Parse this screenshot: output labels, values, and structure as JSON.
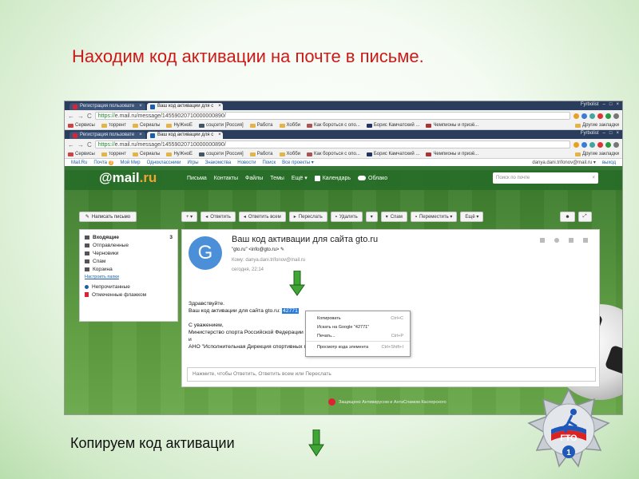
{
  "slide": {
    "title": "Находим код активации на почте в письме.",
    "caption": "Копируем код активации"
  },
  "browser": {
    "tabs": [
      {
        "label": "Регистрация пользовате",
        "active": false
      },
      {
        "label": "Ваш код активации для с",
        "active": true
      }
    ],
    "top_right": "Fyrbolist",
    "url_https": "https://",
    "url_rest": "e.mail.ru/message/14559020710000000890/",
    "bookmarks": [
      "Сервисы",
      "торрент",
      "Сериалы",
      "НуЖноЕ",
      "соцсети [Россия]",
      "Работа",
      "Хобби",
      "Как бороться с опо...",
      "Борис Камчатский ...",
      "Чемпионы и призё..."
    ],
    "other_bookmarks": "Другие закладки"
  },
  "mail": {
    "top_links": [
      "Mail.Ru",
      "Почта",
      "Мой Мир",
      "Одноклассники",
      "Игры",
      "Знакомства",
      "Новости",
      "Поиск",
      "Все проекты ▾"
    ],
    "mail_count": "3",
    "user_email": "danya.dani.trifonov@mail.ru ▾",
    "exit": "выход",
    "logo_at": "@mail",
    "logo_ru": ".ru",
    "nav": [
      "Письма",
      "Контакты",
      "Файлы",
      "Темы",
      "Ещё ▾"
    ],
    "calendar": "Календарь",
    "cloud": "Облако",
    "search_placeholder": "Поиск по почте",
    "write_button": "Написать письмо",
    "toolbar": {
      "plus": "+ ▾",
      "reply": "Ответить",
      "reply_all": "Ответить всем",
      "forward": "Переслать",
      "delete": "Удалить",
      "more_delete": "▾",
      "spam": "Спам",
      "move": "Переместить ▾",
      "more": "Ещё ▾"
    },
    "folders": [
      {
        "name": "Входящие",
        "count": "3",
        "bold": true
      },
      {
        "name": "Отправленные",
        "count": ""
      },
      {
        "name": "Черновики",
        "count": ""
      },
      {
        "name": "Спам",
        "count": ""
      },
      {
        "name": "Корзина",
        "count": ""
      }
    ],
    "folder_settings": "Настроить папки",
    "unread": "Непрочитанные",
    "flagged": "Отмеченные флажком",
    "message": {
      "avatar_letter": "G",
      "subject": "Ваш код активации для сайта gto.ru",
      "from": "\"gto.ru\" <info@gto.ru> ✎",
      "to": "Кому: danya.dani.trifonov@mail.ru",
      "date": "сегодня, 22:14",
      "greeting": "Здравствуйте.",
      "code_line": "Ваш код активации для сайта gto.ru: ",
      "code": "42771",
      "regards": "С уважением,",
      "sign1": "Министерство спорта Российской Федерации",
      "sign2": "и",
      "sign3": "АНО \"Исполнительная Дирекция спортивных программ\"",
      "reply_placeholder": "Нажмите, чтобы Ответить, Ответить всем или Переслать"
    },
    "context_menu": [
      {
        "label": "Копировать",
        "shortcut": "Ctrl+C"
      },
      {
        "label": "Искать на Google \"42771\"",
        "shortcut": ""
      },
      {
        "label": "Печать...",
        "shortcut": "Ctrl+P"
      },
      {
        "label": "Просмотр кода элемента",
        "shortcut": "Ctrl+Shift+I"
      }
    ],
    "sponsor": "Защищено Антивирусом и АнтиСпамом Касперского"
  },
  "badge": {
    "text": "ГТО",
    "number": "1"
  },
  "colors": {
    "title": "#cc1a1a",
    "mail_header": "#2f7a2c",
    "arrow": "#3fa534",
    "highlight": "#2a7bd8"
  }
}
